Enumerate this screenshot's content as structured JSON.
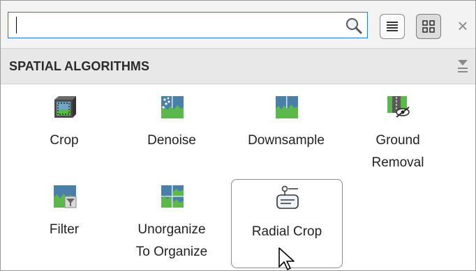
{
  "search": {
    "value": "",
    "placeholder": ""
  },
  "icons": {
    "search": "search-icon",
    "list_view": "list-view-icon",
    "grid_view": "grid-view-icon",
    "close": "close-icon",
    "collapse": "collapse-section-icon"
  },
  "close_glyph": "×",
  "section": {
    "title": "SPATIAL ALGORITHMS"
  },
  "items": [
    {
      "label_1": "Crop",
      "label_2": "",
      "icon": "crop-icon"
    },
    {
      "label_1": "Denoise",
      "label_2": "",
      "icon": "denoise-icon"
    },
    {
      "label_1": "Downsample",
      "label_2": "",
      "icon": "downsample-icon"
    },
    {
      "label_1": "Ground",
      "label_2": "Removal",
      "icon": "ground-removal-icon"
    },
    {
      "label_1": "Filter",
      "label_2": "",
      "icon": "filter-icon"
    },
    {
      "label_1": "Unorganize",
      "label_2": "To Organize",
      "icon": "unorganize-icon"
    },
    {
      "label_1": "Radial Crop",
      "label_2": "",
      "icon": "radial-crop-icon",
      "hovered": true
    }
  ],
  "colors": {
    "accent": "#1e7bd0",
    "icon_green": "#5cb84a",
    "icon_blue": "#4a7fa8"
  }
}
